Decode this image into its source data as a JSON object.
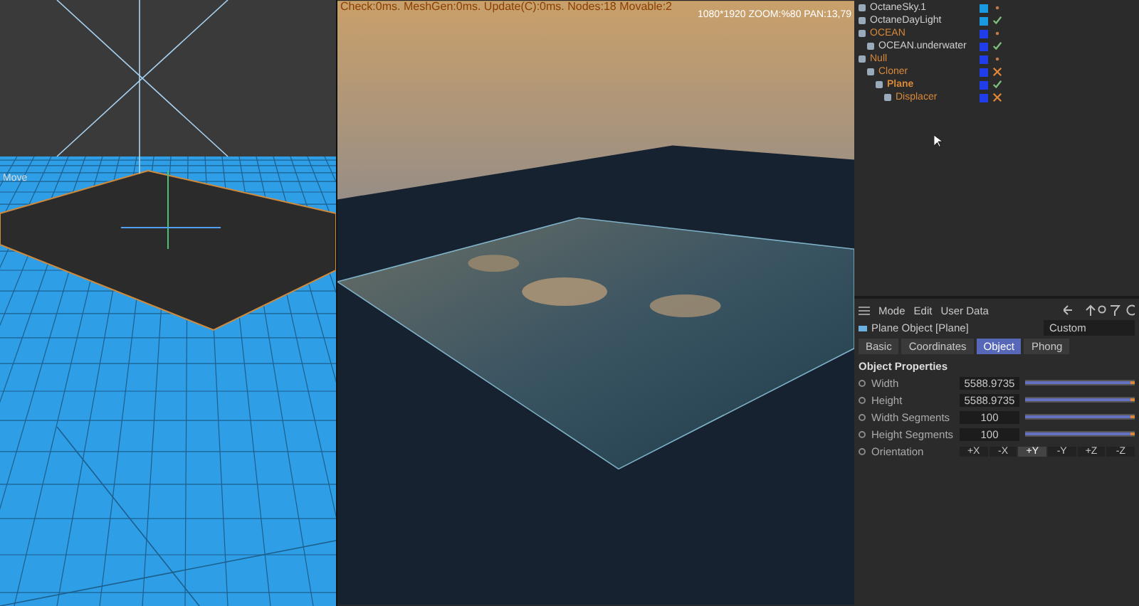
{
  "viewport": {
    "tool_label": "Move"
  },
  "render_view": {
    "stats": "Check:0ms. MeshGen:0ms. Update(C):0ms. Nodes:18 Movable:2",
    "info": "1080*1920 ZOOM:%80  PAN:13,79"
  },
  "object_manager": {
    "items": [
      {
        "name": "OctaneSky.1",
        "active": false,
        "selected": false
      },
      {
        "name": "OctaneDayLight",
        "active": false,
        "selected": false,
        "enabled": true
      },
      {
        "name": "OCEAN",
        "active": true,
        "selected": false,
        "children": [
          {
            "name": "OCEAN.underwater",
            "active": false,
            "selected": false,
            "enabled": true
          }
        ]
      },
      {
        "name": "Null",
        "active": true,
        "selected": false,
        "children": [
          {
            "name": "Cloner",
            "active": true,
            "selected": false,
            "enabled": false,
            "children": [
              {
                "name": "Plane",
                "active": true,
                "selected": true,
                "enabled": true,
                "children": [
                  {
                    "name": "Displacer",
                    "active": true,
                    "selected": false,
                    "enabled": false
                  }
                ]
              }
            ]
          }
        ]
      }
    ]
  },
  "attributes": {
    "menu": [
      "Mode",
      "Edit",
      "User Data"
    ],
    "object_title": "Plane Object [Plane]",
    "preset": "Custom",
    "tabs": [
      {
        "label": "Basic",
        "selected": false
      },
      {
        "label": "Coordinates",
        "selected": false
      },
      {
        "label": "Object",
        "selected": true
      },
      {
        "label": "Phong",
        "selected": false
      }
    ],
    "section": "Object Properties",
    "fields": [
      {
        "label": "Width",
        "value": "5588.9735",
        "level": 1
      },
      {
        "label": "Height",
        "value": "5588.9735",
        "level": 1
      },
      {
        "label": "Width Segments",
        "value": "100",
        "level": 1
      },
      {
        "label": "Height Segments",
        "value": "100",
        "level": 1
      }
    ],
    "orientation": {
      "label": "Orientation",
      "options": [
        {
          "label": "+X",
          "selected": false
        },
        {
          "label": "-X",
          "selected": false
        },
        {
          "label": "+Y",
          "selected": true
        },
        {
          "label": "-Y",
          "selected": false
        },
        {
          "label": "+Z",
          "selected": false
        },
        {
          "label": "-Z",
          "selected": false
        }
      ]
    }
  }
}
